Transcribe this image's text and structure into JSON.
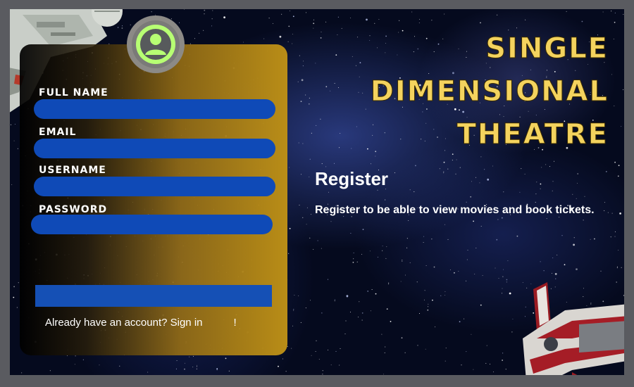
{
  "brand": {
    "title_lines": [
      "SINGLE",
      "DIMENSIONAL",
      "THEATRE"
    ],
    "accent_color": "#f4d35e"
  },
  "intro": {
    "heading": "Register",
    "subtext": "Register to be able to view movies and book tickets."
  },
  "form": {
    "avatar_icon": "user-avatar-icon",
    "fields": [
      {
        "label": "FULL NAME",
        "value": ""
      },
      {
        "label": "EMAIL",
        "value": ""
      },
      {
        "label": "USERNAME",
        "value": ""
      },
      {
        "label": "PASSWORD",
        "value": ""
      }
    ],
    "submit_label": "",
    "signin_prompt": "Already have an account?",
    "signin_link": "Sign in",
    "signin_suffix": "!",
    "input_color": "#0f4ab7"
  }
}
